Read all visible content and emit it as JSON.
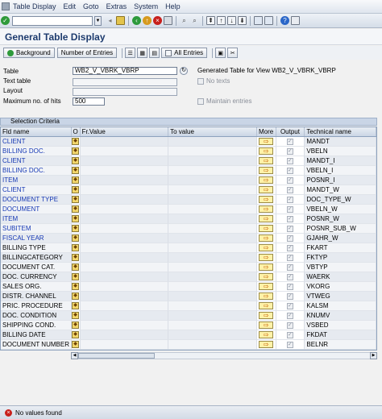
{
  "menu": [
    "Table Display",
    "Edit",
    "Goto",
    "Extras",
    "System",
    "Help"
  ],
  "toolbar": {
    "command_value": ""
  },
  "title": "General Table Display",
  "app_toolbar": {
    "background": "Background",
    "number_of_entries": "Number of Entries",
    "all_entries": "All Entries"
  },
  "header": {
    "table_label": "Table",
    "table_value": "WB2_V_VBRK_VBRP",
    "text_table_label": "Text table",
    "layout_label": "Layout",
    "max_hits_label": "Maximum no. of hits",
    "max_hits_value": "500",
    "generated_info": "Generated Table for View WB2_V_VBRK_VBRP",
    "no_texts": "No texts",
    "maintain_entries": "Maintain entries"
  },
  "selection": {
    "title": "Selection Criteria",
    "columns": [
      "Fld name",
      "O",
      "Fr.Value",
      "To value",
      "More",
      "Output",
      "Technical name"
    ],
    "rows": [
      {
        "name": "CLIENT",
        "tech": "MANDT",
        "key": true
      },
      {
        "name": "BILLING DOC.",
        "tech": "VBELN",
        "key": true
      },
      {
        "name": "CLIENT",
        "tech": "MANDT_I",
        "key": true
      },
      {
        "name": "BILLING DOC.",
        "tech": "VBELN_I",
        "key": true
      },
      {
        "name": "ITEM",
        "tech": "POSNR_I",
        "key": true
      },
      {
        "name": "CLIENT",
        "tech": "MANDT_W",
        "key": true
      },
      {
        "name": "DOCUMENT TYPE",
        "tech": "DOC_TYPE_W",
        "key": true
      },
      {
        "name": "DOCUMENT",
        "tech": "VBELN_W",
        "key": true
      },
      {
        "name": "ITEM",
        "tech": "POSNR_W",
        "key": true
      },
      {
        "name": "SUBITEM",
        "tech": "POSNR_SUB_W",
        "key": true
      },
      {
        "name": "FISCAL YEAR",
        "tech": "GJAHR_W",
        "key": true
      },
      {
        "name": "BILLING TYPE",
        "tech": "FKART",
        "key": false
      },
      {
        "name": "BILLINGCATEGORY",
        "tech": "FKTYP",
        "key": false
      },
      {
        "name": "DOCUMENT CAT.",
        "tech": "VBTYP",
        "key": false
      },
      {
        "name": "DOC. CURRENCY",
        "tech": "WAERK",
        "key": false
      },
      {
        "name": "SALES ORG.",
        "tech": "VKORG",
        "key": false
      },
      {
        "name": "DISTR. CHANNEL",
        "tech": "VTWEG",
        "key": false
      },
      {
        "name": "PRIC. PROCEDURE",
        "tech": "KALSM",
        "key": false
      },
      {
        "name": "DOC. CONDITION",
        "tech": "KNUMV",
        "key": false
      },
      {
        "name": "SHIPPING COND.",
        "tech": "VSBED",
        "key": false
      },
      {
        "name": "BILLING DATE",
        "tech": "FKDAT",
        "key": false
      },
      {
        "name": "DOCUMENT NUMBER",
        "tech": "BELNR",
        "key": false
      }
    ]
  },
  "status": "No values found",
  "colors": {
    "key_field": "#1638b4",
    "title": "#1d3b6e",
    "error": "#c8201c"
  }
}
